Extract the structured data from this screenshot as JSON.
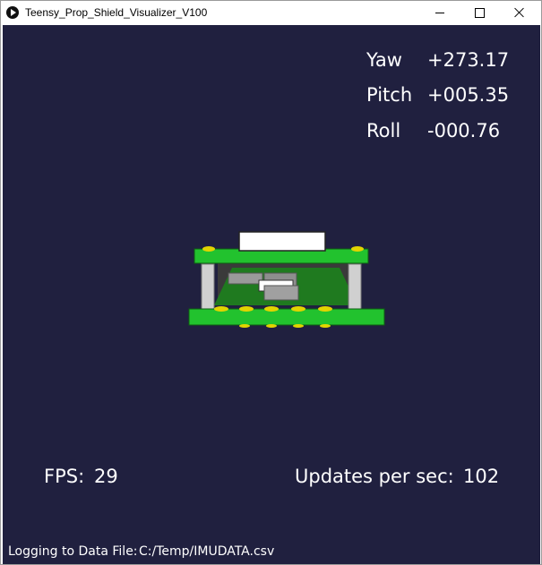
{
  "window": {
    "title": "Teensy_Prop_Shield_Visualizer_V100"
  },
  "orientation": {
    "yaw_label": "Yaw",
    "yaw_value": "+273.17",
    "pitch_label": "Pitch",
    "pitch_value": "+005.35",
    "roll_label": "Roll",
    "roll_value": "-000.76"
  },
  "stats": {
    "fps_label": "FPS:",
    "fps_value": "29",
    "updates_label": "Updates per sec:",
    "updates_value": "102"
  },
  "logging": {
    "label": "Logging to Data File:",
    "path": "C:/Temp/IMUDATA.csv"
  },
  "colors": {
    "background": "#20203f",
    "pcb_green": "#22c22e",
    "standoff": "#d0d0d0",
    "solder_pad": "#e2d400"
  }
}
